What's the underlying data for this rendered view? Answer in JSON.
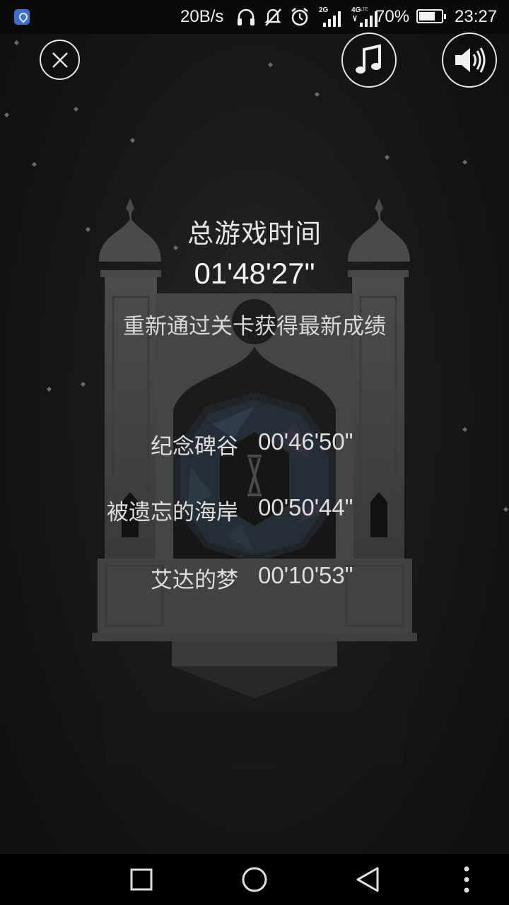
{
  "status_bar": {
    "net_speed": "20B/s",
    "battery_percent": "70%",
    "battery_level": 0.7,
    "time": "23:27",
    "icons": [
      "location-app-icon",
      "headphones-icon",
      "mute-icon",
      "alarm-icon",
      "signal-2g-icon",
      "signal-4g-lte-icon",
      "battery-icon"
    ],
    "signal_labels": {
      "sim1": "2G",
      "sim2": "4G"
    }
  },
  "toolbar": {
    "close_icon": "close-icon",
    "music_icon": "music-note-icon",
    "sound_icon": "speaker-icon"
  },
  "summary": {
    "title": "总游戏时间",
    "total_time": "01'48'27\"",
    "hint": "重新通过关卡获得最新成绩"
  },
  "levels": [
    {
      "name": "纪念碑谷",
      "time": "00'46'50\""
    },
    {
      "name": "被遗忘的海岸",
      "time": "00'50'44\""
    },
    {
      "name": "艾达的梦",
      "time": "00'10'53\""
    }
  ],
  "nav_bar": {
    "icons": [
      "square-recents-icon",
      "circle-home-icon",
      "triangle-back-icon",
      "more-dots-icon"
    ]
  },
  "colors": {
    "background": "#141414",
    "text": "#e6e6e6",
    "temple": "#4a4a4a",
    "status_accent": "#3d6fd1"
  }
}
